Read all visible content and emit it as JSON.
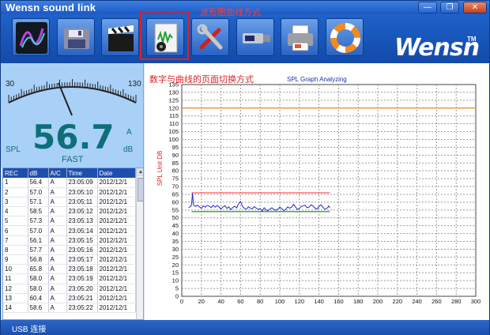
{
  "window": {
    "title": "Wensn sound link",
    "min": "0",
    "max": "1",
    "close": "r"
  },
  "toolbar": {
    "buttons": [
      {
        "id": "realtime",
        "icon": "audio-wave-icon"
      },
      {
        "id": "save",
        "icon": "floppy-disk-icon"
      },
      {
        "id": "record",
        "icon": "clapperboard-icon"
      },
      {
        "id": "graph",
        "icon": "graph-document-icon"
      },
      {
        "id": "settings",
        "icon": "wrench-screwdriver-icon"
      },
      {
        "id": "usb",
        "icon": "usb-drive-icon"
      },
      {
        "id": "print",
        "icon": "printer-icon"
      },
      {
        "id": "help",
        "icon": "lifebuoy-icon"
      }
    ],
    "annotation": "波形图曲线方式",
    "logo": "Wensn",
    "logo_mark": "TM"
  },
  "meter": {
    "scale_min": "30",
    "scale_max": "130",
    "value": "56.7",
    "label_left": "SPL",
    "weighting": "A",
    "unit": "dB",
    "response": "FAST"
  },
  "records": {
    "columns": [
      "REC",
      "dB",
      "A/C",
      "Time",
      "Date"
    ],
    "rows": [
      [
        "1",
        "56.4",
        "A",
        "23:05:09",
        "2012/12/1"
      ],
      [
        "2",
        "57.0",
        "A",
        "23:05:10",
        "2012/12/1"
      ],
      [
        "3",
        "57.1",
        "A",
        "23:05:11",
        "2012/12/1"
      ],
      [
        "4",
        "58.5",
        "A",
        "23:05:12",
        "2012/12/1"
      ],
      [
        "5",
        "57.3",
        "A",
        "23:05:13",
        "2012/12/1"
      ],
      [
        "6",
        "57.0",
        "A",
        "23:05:14",
        "2012/12/1"
      ],
      [
        "7",
        "56.1",
        "A",
        "23:05:15",
        "2012/12/1"
      ],
      [
        "8",
        "57.7",
        "A",
        "23:05:16",
        "2012/12/1"
      ],
      [
        "9",
        "56.8",
        "A",
        "23:05:17",
        "2012/12/1"
      ],
      [
        "10",
        "65.8",
        "A",
        "23:05:18",
        "2012/12/1"
      ],
      [
        "11",
        "58.0",
        "A",
        "23:05:19",
        "2012/12/1"
      ],
      [
        "12",
        "58.0",
        "A",
        "23:05:20",
        "2012/12/1"
      ],
      [
        "13",
        "60.4",
        "A",
        "23:05:21",
        "2012/12/1"
      ],
      [
        "14",
        "58.6",
        "A",
        "23:05:22",
        "2012/12/1"
      ]
    ]
  },
  "chart_caption": "数字与曲线的页面切换方式",
  "chart_data": {
    "type": "line",
    "title": "SPL Graph Analyzing",
    "ylabel": "SPL Unit DB",
    "xlabel": "",
    "xlim": [
      0,
      300
    ],
    "ylim": [
      0,
      135
    ],
    "xticks": [
      0,
      20,
      40,
      60,
      80,
      100,
      120,
      140,
      160,
      180,
      200,
      220,
      240,
      260,
      280,
      300
    ],
    "yticks": [
      0,
      5,
      10,
      15,
      20,
      25,
      30,
      35,
      40,
      45,
      50,
      55,
      60,
      65,
      70,
      75,
      80,
      85,
      90,
      95,
      100,
      105,
      110,
      115,
      120,
      125,
      130,
      135
    ],
    "grid": true,
    "reference_lines": [
      {
        "y": 120,
        "x_range": [
          0,
          300
        ],
        "color": "#f08a2a"
      },
      {
        "y": 66,
        "x_range": [
          10,
          151
        ],
        "color": "#ff5a5a"
      },
      {
        "y": 54,
        "x_range": [
          10,
          151
        ],
        "color": "#2faa2f"
      }
    ],
    "series": [
      {
        "color": "#2626c8",
        "x": [
          7,
          8,
          9,
          10,
          11,
          12,
          14,
          16,
          18,
          20,
          22,
          24,
          26,
          28,
          30,
          32,
          34,
          36,
          38,
          40,
          42,
          44,
          46,
          48,
          50,
          52,
          54,
          56,
          58,
          60,
          62,
          64,
          66,
          68,
          70,
          72,
          74,
          76,
          78,
          80,
          82,
          84,
          86,
          88,
          90,
          92,
          94,
          96,
          98,
          100,
          102,
          104,
          106,
          108,
          110,
          112,
          114,
          116,
          118,
          120,
          122,
          124,
          126,
          128,
          130,
          132,
          134,
          136,
          138,
          140,
          142,
          144,
          146,
          148,
          150,
          151
        ],
        "y": [
          56.4,
          57.0,
          57.1,
          58.5,
          65.8,
          58.0,
          57.3,
          58.0,
          57.0,
          56.1,
          57.7,
          56.8,
          58.0,
          57.5,
          56.5,
          58.0,
          56.8,
          57.9,
          57.0,
          55.6,
          56.9,
          57.8,
          56.0,
          57.0,
          55.2,
          56.6,
          57.5,
          56.3,
          59.0,
          60.4,
          57.2,
          56.0,
          55.5,
          57.1,
          56.1,
          55.8,
          57.2,
          56.2,
          55.4,
          55.9,
          54.3,
          56.4,
          55.0,
          54.6,
          55.7,
          56.4,
          55.2,
          54.9,
          55.4,
          56.8,
          55.9,
          54.7,
          55.2,
          57.0,
          56.2,
          56.7,
          58.6,
          57.1,
          55.3,
          56.0,
          57.3,
          57.6,
          58.1,
          56.4,
          56.9,
          58.3,
          57.5,
          56.1,
          55.6,
          57.2,
          58.3,
          56.8,
          55.5,
          55.9,
          57.6,
          56.4
        ]
      }
    ]
  },
  "status": {
    "text": "USB 连接"
  }
}
